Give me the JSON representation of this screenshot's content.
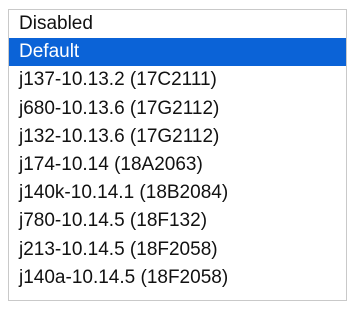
{
  "listbox": {
    "selected_index": 1,
    "accent_color": "#0b63d7",
    "items": [
      {
        "label": "Disabled"
      },
      {
        "label": "Default"
      },
      {
        "label": "j137-10.13.2 (17C2111)"
      },
      {
        "label": "j680-10.13.6 (17G2112)"
      },
      {
        "label": "j132-10.13.6 (17G2112)"
      },
      {
        "label": "j174-10.14 (18A2063)"
      },
      {
        "label": "j140k-10.14.1 (18B2084)"
      },
      {
        "label": "j780-10.14.5 (18F132)"
      },
      {
        "label": "j213-10.14.5 (18F2058)"
      },
      {
        "label": "j140a-10.14.5 (18F2058)"
      }
    ]
  }
}
